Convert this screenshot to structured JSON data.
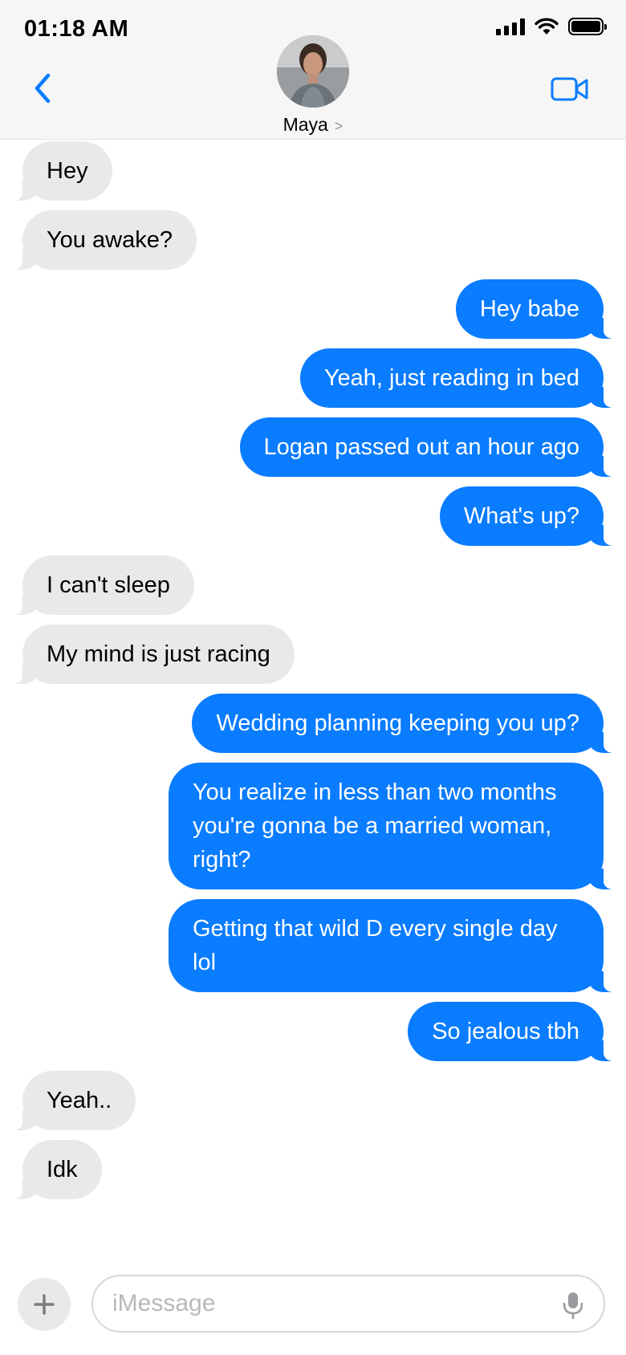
{
  "status_bar": {
    "time": "01:18 AM",
    "icons": [
      "signal-bars-icon",
      "wifi-icon",
      "battery-icon"
    ],
    "battery_level": 1.0
  },
  "header": {
    "contact_name": "Maya",
    "chevron": ">",
    "back_icon": "chevron-left-icon",
    "video_icon": "video-camera-icon",
    "accent_color": "#0a7cff",
    "background_color": "#f6f6f6"
  },
  "messages": [
    {
      "direction": "in",
      "text": "Hey"
    },
    {
      "direction": "in",
      "text": "You awake?"
    },
    {
      "direction": "out",
      "text": "Hey babe"
    },
    {
      "direction": "out",
      "text": "Yeah, just reading in bed"
    },
    {
      "direction": "out",
      "text": "Logan passed out an hour ago"
    },
    {
      "direction": "out",
      "text": "What's up?"
    },
    {
      "direction": "in",
      "text": "I can't sleep"
    },
    {
      "direction": "in",
      "text": "My mind is just racing"
    },
    {
      "direction": "out",
      "text": "Wedding planning keeping you up?"
    },
    {
      "direction": "out",
      "text": "You realize in less than two months you're gonna be a married woman, right?"
    },
    {
      "direction": "out",
      "text": "Getting that wild D every single day lol"
    },
    {
      "direction": "out",
      "text": "So jealous tbh"
    },
    {
      "direction": "in",
      "text": "Yeah.."
    },
    {
      "direction": "in",
      "text": "Idk"
    }
  ],
  "bubble_colors": {
    "incoming": "#e9e9eb",
    "outgoing": "#0a7cff"
  },
  "composer": {
    "placeholder": "iMessage",
    "value": "",
    "plus_icon": "plus-icon",
    "mic_icon": "microphone-icon"
  }
}
